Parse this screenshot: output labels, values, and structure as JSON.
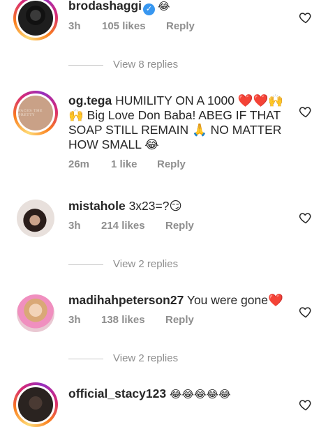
{
  "comments": [
    {
      "username": "brodashaggi",
      "verified": true,
      "text": "😂",
      "time": "3h",
      "likes": "105 likes",
      "reply_label": "Reply",
      "view_replies": "View 8 replies"
    },
    {
      "username": "og.tega",
      "text": "HUMILITY ON A 1000 ❤️❤️🙌 🙌 Big Love Don Baba! ABEG IF THAT SOAP STILL REMAIN 🙏 NO MATTER HOW SMALL 😂",
      "time": "26m",
      "likes": "1 like",
      "reply_label": "Reply",
      "avatar_text": "FACES THE PRETTY"
    },
    {
      "username": "mistahole",
      "text": "3x23=?😏",
      "time": "3h",
      "likes": "214 likes",
      "reply_label": "Reply",
      "view_replies": "View 2 replies"
    },
    {
      "username": "madihahpeterson27",
      "text": "You were gone❤️",
      "time": "3h",
      "likes": "138 likes",
      "reply_label": "Reply",
      "view_replies": "View 2 replies"
    },
    {
      "username": "official_stacy123",
      "text": "😂😂😂😂😂"
    }
  ],
  "colors": {
    "text": "#262626",
    "secondary": "#8e8e8e",
    "verified": "#3897f0",
    "heart_emoji": "#e0162b"
  },
  "icons": {
    "like": "heart-outline-icon",
    "verified": "verified-badge-icon"
  }
}
